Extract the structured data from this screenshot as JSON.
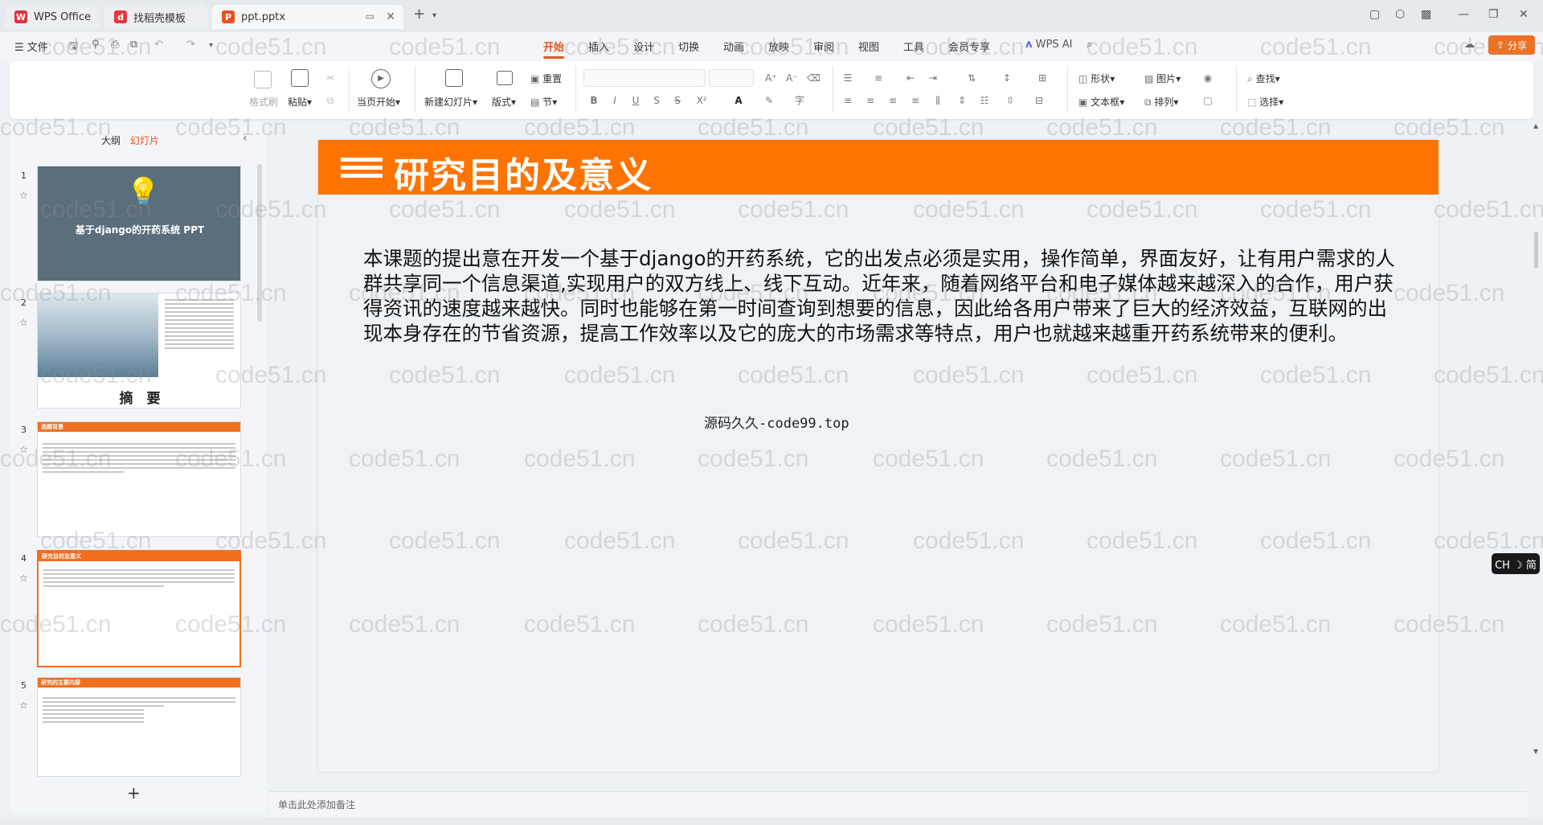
{
  "tabs": [
    {
      "label": "WPS Office",
      "icon": "wps-logo-icon",
      "color": "#d9363e"
    },
    {
      "label": "找稻壳模板",
      "icon": "docer-icon",
      "color": "#e0393e"
    },
    {
      "label": "ppt.pptx",
      "icon": "ppt-file-icon",
      "color": "#e8531f"
    }
  ],
  "menu": {
    "file": "文件",
    "items": [
      "开始",
      "插入",
      "设计",
      "切换",
      "动画",
      "放映",
      "审阅",
      "视图",
      "工具",
      "会员专享"
    ],
    "active": "开始",
    "wps_ai": "WPS AI",
    "share": "分享"
  },
  "ribbon": {
    "format_painter": "格式刷",
    "paste": "粘贴",
    "play_from_current": "当页开始",
    "new_slide": "新建幻灯片",
    "layout": "版式",
    "reset": "重置",
    "section": "节",
    "shape": "形状",
    "picture": "图片",
    "textbox": "文本框",
    "arrange": "排列",
    "find": "查找",
    "select": "选择"
  },
  "panel": {
    "outline_tab": "大纲",
    "slides_tab": "幻灯片",
    "add_label": "+"
  },
  "thumbnails": [
    {
      "number": "1",
      "title": "基于django的开药系统 PPT"
    },
    {
      "number": "2",
      "title": "摘　要"
    },
    {
      "number": "3",
      "title": "选题背景"
    },
    {
      "number": "4",
      "title": "研究目的及意义"
    },
    {
      "number": "5",
      "title": "研究的主要内容"
    }
  ],
  "slide": {
    "title": "研究目的及意义",
    "body": "本课题的提出意在开发一个基于django的开药系统，它的出发点必须是实用，操作简单，界面友好，让有用户需求的人群共享同一个信息渠道,实现用户的双方线上、线下互动。近年来，随着网络平台和电子媒体越来越深入的合作，用户获得资讯的速度越来越快。同时也能够在第一时间查询到想要的信息，因此给各用户带来了巨大的经济效益，互联网的出现本身存在的节省资源，提高工作效率以及它的庞大的市场需求等特点，用户也就越来越重开药系统带来的便利。",
    "source": "源码久久-code99.top",
    "header_color": "#ff7300"
  },
  "notes_placeholder": "单击此处添加备注",
  "ime_badge": "CH ☽ 简",
  "watermark": "code51.cn",
  "colors": {
    "accent": "#e8531f",
    "slide_header": "#ff7300"
  }
}
